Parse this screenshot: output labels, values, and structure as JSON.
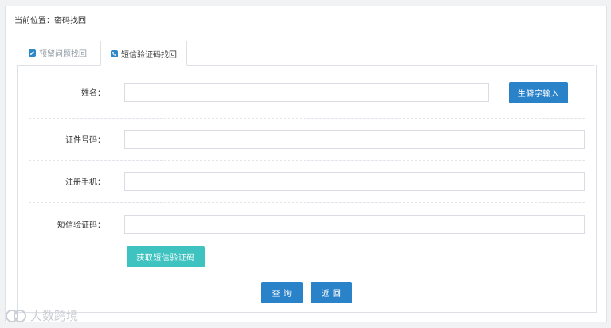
{
  "breadcrumb": {
    "text": "当前位置：密码找回"
  },
  "tabs": [
    {
      "label": "预留问题找回",
      "icon": "edit-icon",
      "active": false
    },
    {
      "label": "短信验证码找回",
      "icon": "phone-icon",
      "active": true
    }
  ],
  "form": {
    "name_label": "姓名：",
    "name_value": "",
    "rare_char_button": "生僻字输入",
    "id_label": "证件号码：",
    "id_value": "",
    "phone_label": "注册手机：",
    "phone_value": "",
    "sms_label": "短信验证码：",
    "sms_value": "",
    "get_sms_button": "获取短信验证码"
  },
  "actions": {
    "query": "查 询",
    "back": "返 回"
  },
  "watermark": {
    "text": "大数跨境"
  },
  "colors": {
    "primary": "#2a82c9",
    "teal": "#3fc3c0"
  }
}
